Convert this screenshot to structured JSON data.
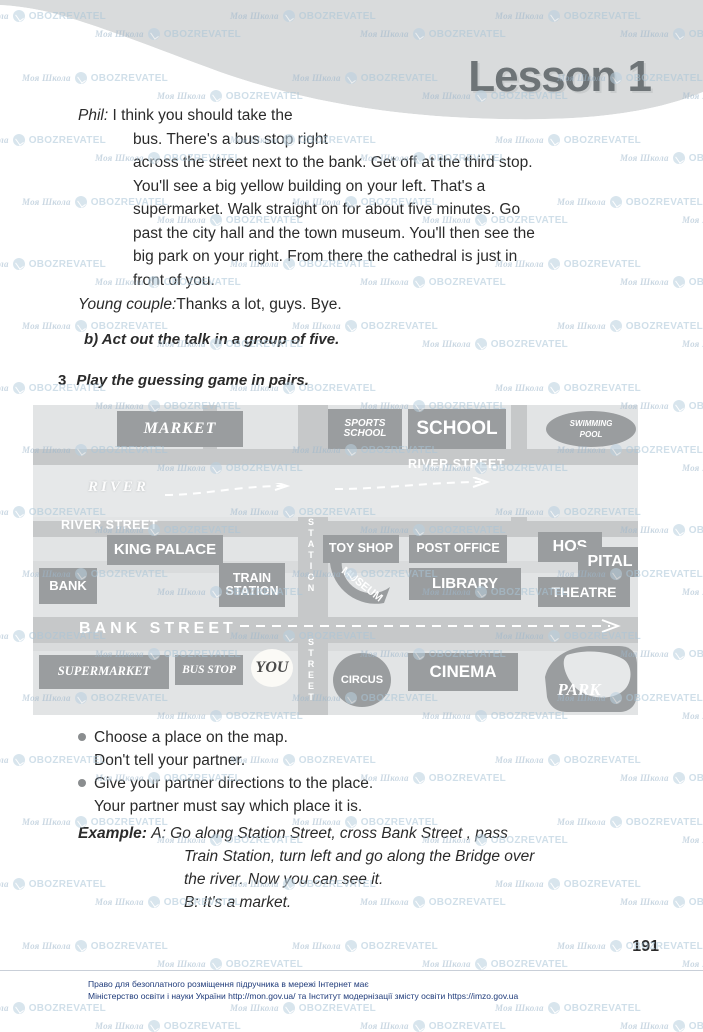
{
  "header": {
    "lesson_title": "Lesson 1"
  },
  "dialogue": {
    "phil_speaker": "Phil:",
    "phil_lines": [
      "I think you should take the",
      "bus. There's a bus stop right",
      "across the street next to the bank. Get off at the third stop.",
      "You'll see a big yellow building on your left. That's a",
      "supermarket. Walk straight on for about five minutes. Go",
      "past the city hall and the town museum. You'll then see the",
      "big park on your right. From there the cathedral is just in",
      "front of you."
    ],
    "young_speaker": "Young couple:",
    "young_text": "Thanks a lot, guys. Bye."
  },
  "task_b": {
    "label": "b) Act out the talk in a group of five."
  },
  "task_3": {
    "number": "3",
    "label": "Play the guessing game in pairs."
  },
  "map": {
    "streets": {
      "river_street_left": "RIVER STREET",
      "river_street_right": "RIVER STREET",
      "bank_street": "BANK STREET",
      "station_street_top": "STATION",
      "station_street_bottom": "STREET"
    },
    "river_label": "RIVER",
    "places": [
      {
        "name": "MARKET"
      },
      {
        "name": "SPORTS SCHOOL"
      },
      {
        "name": "SCHOOL"
      },
      {
        "name": "SWIMMING POOL"
      },
      {
        "name": "KING PALACE"
      },
      {
        "name": "TOY SHOP"
      },
      {
        "name": "POST OFFICE"
      },
      {
        "name": "HOS"
      },
      {
        "name": "PITAL"
      },
      {
        "name": "BANK"
      },
      {
        "name": "TRAIN STATION"
      },
      {
        "name": "MUSEUM"
      },
      {
        "name": "LIBRARY"
      },
      {
        "name": "THEATRE"
      },
      {
        "name": "SUPERMARKET"
      },
      {
        "name": "BUS STOP"
      },
      {
        "name": "YOU"
      },
      {
        "name": "CIRCUS"
      },
      {
        "name": "CINEMA"
      },
      {
        "name": "PARK"
      }
    ],
    "labels": {
      "market": "MARKET",
      "sports_school_1": "SPORTS",
      "sports_school_2": "SCHOOL",
      "school": "SCHOOL",
      "swimming_1": "SWIMMING",
      "swimming_2": "POOL",
      "king_palace": "KING PALACE",
      "toy_shop": "TOY SHOP",
      "post_office": "POST OFFICE",
      "hos": "HOS",
      "pital": "PITAL",
      "bank": "BANK",
      "train_1": "TRAIN",
      "train_2": "STATION",
      "museum": "MUSEUM",
      "library": "LIBRARY",
      "theatre": "THEATRE",
      "supermarket": "SUPERMARKET",
      "bus_stop": "BUS STOP",
      "you": "YOU",
      "circus": "CIRCUS",
      "cinema": "CINEMA",
      "park": "PARK"
    }
  },
  "instructions": {
    "bullet1": "Choose a place on the map.",
    "bullet1_sub": "Don't tell your partner.",
    "bullet2": "Give your partner directions to the place.",
    "bullet2_sub": "Your partner must say which place it is."
  },
  "example": {
    "label": "Example:",
    "line_a1": "A: Go along Station Street, cross Bank Street , pass",
    "line_a2": "Train Station, turn left and go along the Bridge over",
    "line_a3": "the river. Now you can see it.",
    "line_b": "B: It's a market."
  },
  "page_number": "191",
  "footer": {
    "line1": "Право для безоплатного розміщення підручника в мережі Інтернет має",
    "line2": "Міністерство освіти і науки України http://mon.gov.ua/ та Інститут модернізації змісту освіти https://imzo.gov.ua"
  },
  "watermark": {
    "brand_left": "Моя Школа",
    "brand_right": "OBOZREVATEL"
  },
  "colors": {
    "banner": "#d9dbdc",
    "map_bg": "#d9dbdc",
    "building": "#9a9d9f",
    "road": "#c6c8c9",
    "title": "#6e7477",
    "footer_text": "#1f3b7a"
  }
}
